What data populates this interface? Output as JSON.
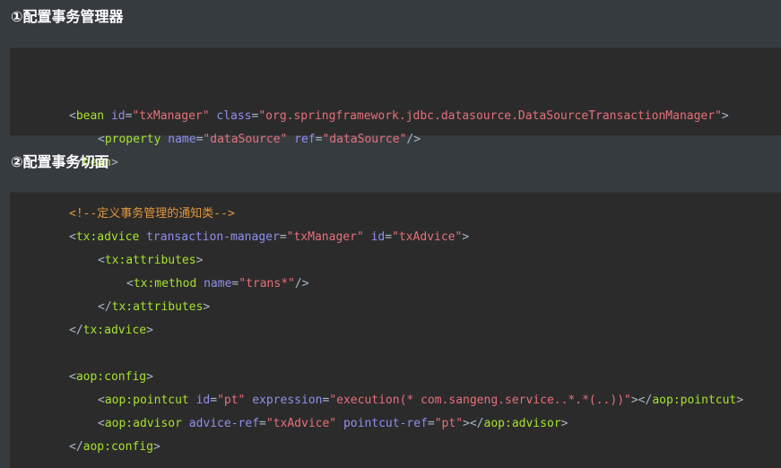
{
  "sections": [
    {
      "title": "①配置事务管理器",
      "code": [
        {
          "indent": 0,
          "tokens": [
            {
              "k": "b",
              "v": "<"
            },
            {
              "k": "t",
              "v": "bean"
            },
            {
              "k": "b",
              "v": " "
            },
            {
              "k": "a",
              "v": "id"
            },
            {
              "k": "b",
              "v": "="
            },
            {
              "k": "s",
              "v": "\"txManager\""
            },
            {
              "k": "b",
              "v": " "
            },
            {
              "k": "a",
              "v": "class"
            },
            {
              "k": "b",
              "v": "="
            },
            {
              "k": "s",
              "v": "\"org.springframework.jdbc.datasource.DataSourceTransactionManager\""
            },
            {
              "k": "b",
              "v": ">"
            }
          ]
        },
        {
          "indent": 1,
          "tokens": [
            {
              "k": "b",
              "v": "<"
            },
            {
              "k": "t",
              "v": "property"
            },
            {
              "k": "b",
              "v": " "
            },
            {
              "k": "a",
              "v": "name"
            },
            {
              "k": "b",
              "v": "="
            },
            {
              "k": "s",
              "v": "\"dataSource\""
            },
            {
              "k": "b",
              "v": " "
            },
            {
              "k": "a",
              "v": "ref"
            },
            {
              "k": "b",
              "v": "="
            },
            {
              "k": "s",
              "v": "\"dataSource\""
            },
            {
              "k": "b",
              "v": "/>"
            }
          ]
        },
        {
          "indent": 0,
          "tokens": [
            {
              "k": "b",
              "v": "</"
            },
            {
              "k": "t",
              "v": "bean"
            },
            {
              "k": "b",
              "v": ">"
            }
          ]
        }
      ]
    },
    {
      "title": "②配置事务切面",
      "code": [
        {
          "indent": 0,
          "tokens": [
            {
              "k": "c",
              "v": "<!--定义事务管理的通知类-->"
            }
          ]
        },
        {
          "indent": 0,
          "tokens": [
            {
              "k": "b",
              "v": "<"
            },
            {
              "k": "t",
              "v": "tx:advice"
            },
            {
              "k": "b",
              "v": " "
            },
            {
              "k": "a",
              "v": "transaction-manager"
            },
            {
              "k": "b",
              "v": "="
            },
            {
              "k": "s",
              "v": "\"txManager\""
            },
            {
              "k": "b",
              "v": " "
            },
            {
              "k": "a",
              "v": "id"
            },
            {
              "k": "b",
              "v": "="
            },
            {
              "k": "s",
              "v": "\"txAdvice\""
            },
            {
              "k": "b",
              "v": ">"
            }
          ]
        },
        {
          "indent": 1,
          "tokens": [
            {
              "k": "b",
              "v": "<"
            },
            {
              "k": "t",
              "v": "tx:attributes"
            },
            {
              "k": "b",
              "v": ">"
            }
          ]
        },
        {
          "indent": 2,
          "tokens": [
            {
              "k": "b",
              "v": "<"
            },
            {
              "k": "t",
              "v": "tx:method"
            },
            {
              "k": "b",
              "v": " "
            },
            {
              "k": "a",
              "v": "name"
            },
            {
              "k": "b",
              "v": "="
            },
            {
              "k": "s",
              "v": "\"trans*\""
            },
            {
              "k": "b",
              "v": "/>"
            }
          ]
        },
        {
          "indent": 1,
          "tokens": [
            {
              "k": "b",
              "v": "</"
            },
            {
              "k": "t",
              "v": "tx:attributes"
            },
            {
              "k": "b",
              "v": ">"
            }
          ]
        },
        {
          "indent": 0,
          "tokens": [
            {
              "k": "b",
              "v": "</"
            },
            {
              "k": "t",
              "v": "tx:advice"
            },
            {
              "k": "b",
              "v": ">"
            }
          ]
        },
        {
          "indent": 0,
          "tokens": []
        },
        {
          "indent": 0,
          "tokens": [
            {
              "k": "b",
              "v": "<"
            },
            {
              "k": "t",
              "v": "aop:config"
            },
            {
              "k": "b",
              "v": ">"
            }
          ]
        },
        {
          "indent": 1,
          "tokens": [
            {
              "k": "b",
              "v": "<"
            },
            {
              "k": "t",
              "v": "aop:pointcut"
            },
            {
              "k": "b",
              "v": " "
            },
            {
              "k": "a",
              "v": "id"
            },
            {
              "k": "b",
              "v": "="
            },
            {
              "k": "s",
              "v": "\"pt\""
            },
            {
              "k": "b",
              "v": " "
            },
            {
              "k": "a",
              "v": "expression"
            },
            {
              "k": "b",
              "v": "="
            },
            {
              "k": "s",
              "v": "\"execution(* com.sangeng.service..*.*(..))\""
            },
            {
              "k": "b",
              "v": "></"
            },
            {
              "k": "t",
              "v": "aop:pointcut"
            },
            {
              "k": "b",
              "v": ">"
            }
          ]
        },
        {
          "indent": 1,
          "tokens": [
            {
              "k": "b",
              "v": "<"
            },
            {
              "k": "t",
              "v": "aop:advisor"
            },
            {
              "k": "b",
              "v": " "
            },
            {
              "k": "a",
              "v": "advice-ref"
            },
            {
              "k": "b",
              "v": "="
            },
            {
              "k": "s",
              "v": "\"txAdvice\""
            },
            {
              "k": "b",
              "v": " "
            },
            {
              "k": "a",
              "v": "pointcut-ref"
            },
            {
              "k": "b",
              "v": "="
            },
            {
              "k": "s",
              "v": "\"pt\""
            },
            {
              "k": "b",
              "v": "></"
            },
            {
              "k": "t",
              "v": "aop:advisor"
            },
            {
              "k": "b",
              "v": ">"
            }
          ]
        },
        {
          "indent": 0,
          "tokens": [
            {
              "k": "b",
              "v": "</"
            },
            {
              "k": "t",
              "v": "aop:config"
            },
            {
              "k": "b",
              "v": ">"
            }
          ]
        }
      ]
    }
  ],
  "colors": {
    "page_background": "#363b40",
    "code_background": "#2b2b2b",
    "heading": "#ffffff",
    "punctuation": "#a9b7c6",
    "tag": "#a6e22e",
    "attribute": "#8f8fef",
    "string": "#e6707a",
    "comment": "#e2963a"
  }
}
